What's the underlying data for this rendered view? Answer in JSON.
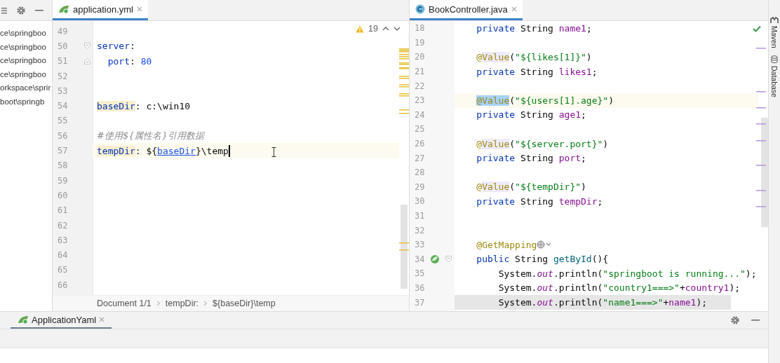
{
  "project_panel": {
    "items": [
      {
        "label": "ce\\springboo"
      },
      {
        "label": "ce\\springboo"
      },
      {
        "label": "ce\\springboo"
      },
      {
        "label": "ce\\springboo"
      },
      {
        "label": "orkspace\\sprir"
      },
      {
        "label": "boot\\springb"
      }
    ]
  },
  "yaml_editor": {
    "tab": {
      "label": "application.yml",
      "selected": true
    },
    "focused": true,
    "warnings": {
      "count": "19"
    },
    "lines": [
      {
        "number": "49",
        "current": false,
        "fold_start": false,
        "fold_end": false
      },
      {
        "number": "50",
        "current": false,
        "fold_start": true,
        "fold_end": false,
        "tokens": [
          {
            "kind": "key",
            "text": "server"
          },
          {
            "kind": "plain",
            "text": ":"
          }
        ]
      },
      {
        "number": "51",
        "current": false,
        "fold_start": false,
        "fold_end": true,
        "tokens": [
          {
            "kind": "key",
            "text": "  port"
          },
          {
            "kind": "plain",
            "text": ": "
          },
          {
            "kind": "number",
            "text": "80"
          }
        ]
      },
      {
        "number": "52",
        "current": false,
        "fold_start": false,
        "fold_end": false
      },
      {
        "number": "53",
        "current": false,
        "fold_start": false,
        "fold_end": false
      },
      {
        "number": "54",
        "current": false,
        "fold_start": false,
        "fold_end": false,
        "tokens": [
          {
            "kind": "key-marked",
            "text": "baseDir"
          },
          {
            "kind": "plain",
            "text": ": c:\\win10"
          }
        ]
      },
      {
        "number": "55",
        "current": false,
        "fold_start": false,
        "fold_end": false
      },
      {
        "number": "56",
        "current": false,
        "fold_start": false,
        "fold_end": false,
        "tokens": [
          {
            "kind": "comment",
            "text": "#使用${属性名}引用数据"
          }
        ]
      },
      {
        "number": "57",
        "current": true,
        "fold_start": false,
        "fold_end": false,
        "tokens": [
          {
            "kind": "key-marked",
            "text": "tempDir"
          },
          {
            "kind": "plain",
            "text": ": ${"
          },
          {
            "kind": "ref",
            "text": "baseDir"
          },
          {
            "kind": "plain",
            "text": "}\\temp"
          }
        ]
      },
      {
        "number": "58",
        "current": false,
        "fold_start": false,
        "fold_end": false
      },
      {
        "number": "59",
        "current": false,
        "fold_start": false,
        "fold_end": false
      },
      {
        "number": "60",
        "current": false,
        "fold_start": false,
        "fold_end": false
      },
      {
        "number": "61",
        "current": false,
        "fold_start": false,
        "fold_end": false
      },
      {
        "number": "62",
        "current": false,
        "fold_start": false,
        "fold_end": false
      },
      {
        "number": "63",
        "current": false,
        "fold_start": false,
        "fold_end": false
      },
      {
        "number": "64",
        "current": false,
        "fold_start": false,
        "fold_end": false
      },
      {
        "number": "65",
        "current": false,
        "fold_start": false,
        "fold_end": false
      },
      {
        "number": "66",
        "current": false,
        "fold_start": false,
        "fold_end": false
      }
    ],
    "breadcrumbs": [
      "Document 1/1",
      "tempDir:",
      "${baseDir}\\temp"
    ]
  },
  "java_editor": {
    "tab": {
      "label": "BookController.java",
      "selected": true
    },
    "focused": false,
    "lines": [
      {
        "number": "18",
        "current": false,
        "shaded": false,
        "fold_start": false,
        "gutter_icon": false,
        "web_hint": false,
        "tokens": [
          {
            "kind": "keyword",
            "text": "    private"
          },
          {
            "kind": "plain",
            "text": " String "
          },
          {
            "kind": "field",
            "text": "name1"
          },
          {
            "kind": "plain",
            "text": ";"
          }
        ]
      },
      {
        "number": "19",
        "current": false,
        "shaded": false,
        "fold_start": false,
        "gutter_icon": false,
        "web_hint": false
      },
      {
        "number": "20",
        "current": false,
        "shaded": false,
        "fold_start": false,
        "gutter_icon": false,
        "web_hint": false,
        "tokens": [
          {
            "kind": "annotation",
            "text": "    @"
          },
          {
            "kind": "annotation-marked",
            "text": "Value"
          },
          {
            "kind": "plain",
            "text": "("
          },
          {
            "kind": "string",
            "text": "\"${likes[1]}\""
          },
          {
            "kind": "plain",
            "text": ")"
          }
        ]
      },
      {
        "number": "21",
        "current": false,
        "shaded": false,
        "fold_start": false,
        "gutter_icon": false,
        "web_hint": false,
        "tokens": [
          {
            "kind": "keyword",
            "text": "    private"
          },
          {
            "kind": "plain",
            "text": " String "
          },
          {
            "kind": "field",
            "text": "likes1"
          },
          {
            "kind": "plain",
            "text": ";"
          }
        ]
      },
      {
        "number": "22",
        "current": false,
        "shaded": false,
        "fold_start": false,
        "gutter_icon": false,
        "web_hint": false
      },
      {
        "number": "23",
        "current": true,
        "shaded": false,
        "fold_start": false,
        "gutter_icon": false,
        "web_hint": false,
        "tokens": [
          {
            "kind": "selection",
            "text": "    @Value"
          },
          {
            "kind": "plain",
            "text": "("
          },
          {
            "kind": "string",
            "text": "\"${users[1].age}\""
          },
          {
            "kind": "plain",
            "text": ")"
          }
        ]
      },
      {
        "number": "24",
        "current": false,
        "shaded": false,
        "fold_start": false,
        "gutter_icon": false,
        "web_hint": false,
        "tokens": [
          {
            "kind": "keyword",
            "text": "    private"
          },
          {
            "kind": "plain",
            "text": " String "
          },
          {
            "kind": "field",
            "text": "age1"
          },
          {
            "kind": "plain",
            "text": ";"
          }
        ]
      },
      {
        "number": "25",
        "current": false,
        "shaded": false,
        "fold_start": false,
        "gutter_icon": false,
        "web_hint": false
      },
      {
        "number": "26",
        "current": false,
        "shaded": false,
        "fold_start": false,
        "gutter_icon": false,
        "web_hint": false,
        "tokens": [
          {
            "kind": "annotation",
            "text": "    @"
          },
          {
            "kind": "annotation-marked",
            "text": "Value"
          },
          {
            "kind": "plain",
            "text": "("
          },
          {
            "kind": "string",
            "text": "\"${server.port}\""
          },
          {
            "kind": "plain",
            "text": ")"
          }
        ]
      },
      {
        "number": "27",
        "current": false,
        "shaded": false,
        "fold_start": false,
        "gutter_icon": false,
        "web_hint": false,
        "tokens": [
          {
            "kind": "keyword",
            "text": "    private"
          },
          {
            "kind": "plain",
            "text": " String "
          },
          {
            "kind": "field",
            "text": "port"
          },
          {
            "kind": "plain",
            "text": ";"
          }
        ]
      },
      {
        "number": "28",
        "current": false,
        "shaded": false,
        "fold_start": false,
        "gutter_icon": false,
        "web_hint": false
      },
      {
        "number": "29",
        "current": false,
        "shaded": false,
        "fold_start": false,
        "gutter_icon": false,
        "web_hint": false,
        "tokens": [
          {
            "kind": "annotation",
            "text": "    @"
          },
          {
            "kind": "annotation-marked",
            "text": "Value"
          },
          {
            "kind": "plain",
            "text": "("
          },
          {
            "kind": "string",
            "text": "\"${tempDir}\""
          },
          {
            "kind": "plain",
            "text": ")"
          }
        ]
      },
      {
        "number": "30",
        "current": false,
        "shaded": false,
        "fold_start": false,
        "gutter_icon": false,
        "web_hint": false,
        "tokens": [
          {
            "kind": "keyword",
            "text": "    private"
          },
          {
            "kind": "plain",
            "text": " String "
          },
          {
            "kind": "field",
            "text": "tempDir"
          },
          {
            "kind": "plain",
            "text": ";"
          }
        ]
      },
      {
        "number": "31",
        "current": false,
        "shaded": false,
        "fold_start": false,
        "gutter_icon": false,
        "web_hint": false
      },
      {
        "number": "32",
        "current": false,
        "shaded": false,
        "fold_start": false,
        "gutter_icon": false,
        "web_hint": false
      },
      {
        "number": "33",
        "current": false,
        "shaded": false,
        "fold_start": false,
        "gutter_icon": false,
        "web_hint": true,
        "tokens": [
          {
            "kind": "annotation",
            "text": "    @GetMapping"
          }
        ]
      },
      {
        "number": "34",
        "current": false,
        "shaded": false,
        "fold_start": true,
        "gutter_icon": true,
        "web_hint": false,
        "tokens": [
          {
            "kind": "keyword",
            "text": "    public"
          },
          {
            "kind": "plain",
            "text": " String "
          },
          {
            "kind": "method",
            "text": "getById"
          },
          {
            "kind": "plain",
            "text": "(){"
          }
        ]
      },
      {
        "number": "35",
        "current": false,
        "shaded": false,
        "fold_start": false,
        "gutter_icon": false,
        "web_hint": false,
        "tokens": [
          {
            "kind": "plain",
            "text": "        System."
          },
          {
            "kind": "static",
            "text": "out"
          },
          {
            "kind": "plain",
            "text": ".println("
          },
          {
            "kind": "string",
            "text": "\"springboot is running...\""
          },
          {
            "kind": "plain",
            "text": ");"
          }
        ]
      },
      {
        "number": "36",
        "current": false,
        "shaded": false,
        "fold_start": false,
        "gutter_icon": false,
        "web_hint": false,
        "tokens": [
          {
            "kind": "plain",
            "text": "        System."
          },
          {
            "kind": "static",
            "text": "out"
          },
          {
            "kind": "plain",
            "text": ".println("
          },
          {
            "kind": "string",
            "text": "\"country1===>\""
          },
          {
            "kind": "plain",
            "text": "+"
          },
          {
            "kind": "field",
            "text": "country1"
          },
          {
            "kind": "plain",
            "text": ");"
          }
        ]
      },
      {
        "number": "37",
        "current": false,
        "shaded": true,
        "fold_start": false,
        "gutter_icon": false,
        "web_hint": false,
        "tokens": [
          {
            "kind": "plain",
            "text": "        System."
          },
          {
            "kind": "static",
            "text": "out"
          },
          {
            "kind": "plain",
            "text": ".println("
          },
          {
            "kind": "string",
            "text": "\"name1===>\""
          },
          {
            "kind": "plain",
            "text": "+"
          },
          {
            "kind": "field",
            "text": "name1"
          },
          {
            "kind": "plain",
            "text": ");"
          }
        ]
      }
    ]
  },
  "bottom_panel": {
    "tab": {
      "label": "ApplicationYaml",
      "selected": true
    }
  },
  "right_strip": {
    "items": [
      "Maven",
      "Database"
    ]
  }
}
